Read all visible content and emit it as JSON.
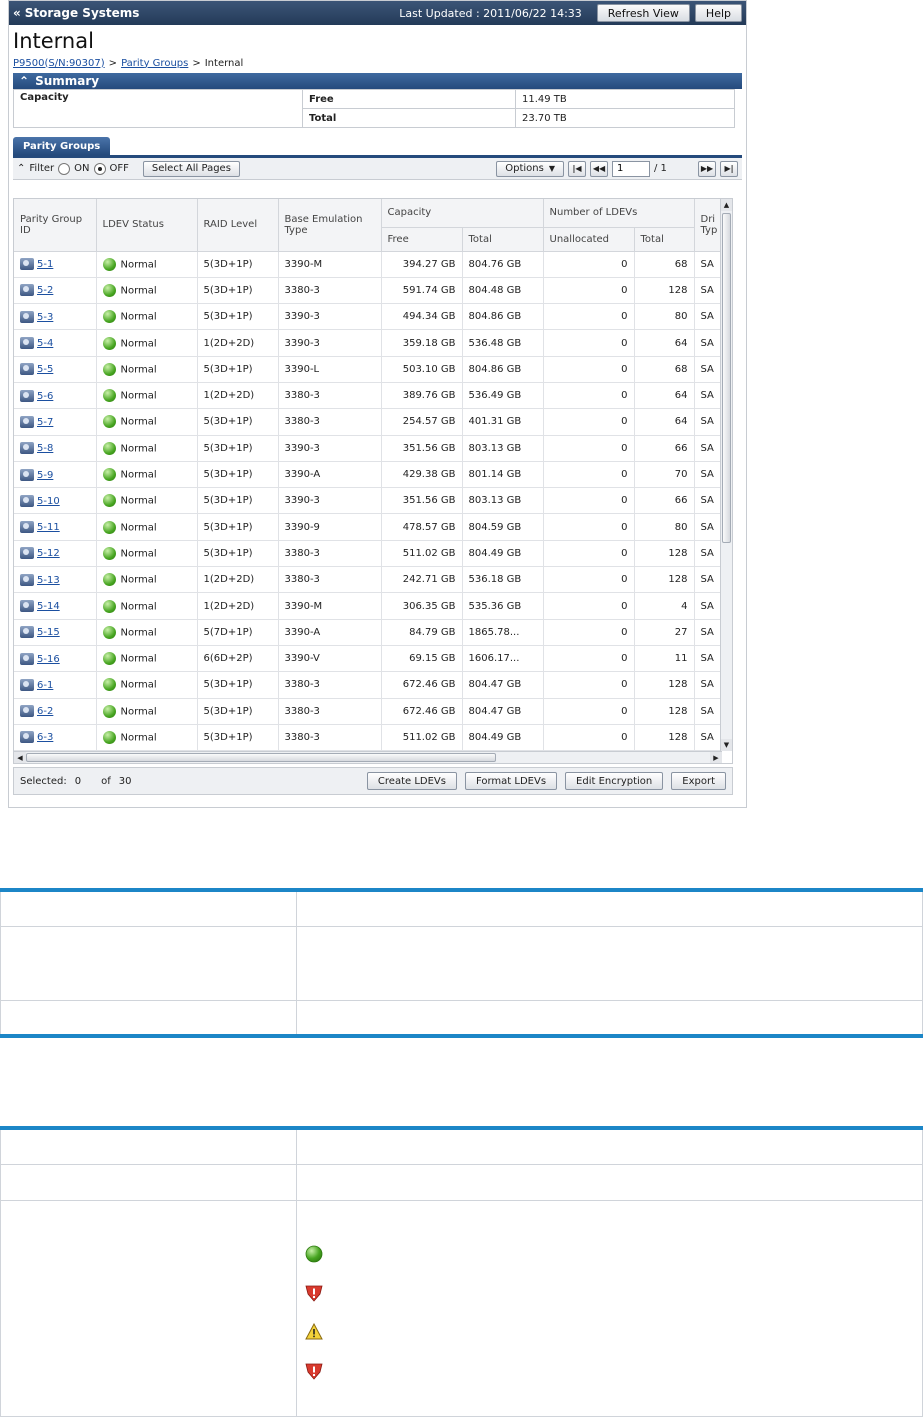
{
  "topbar": {
    "title": "Storage Systems",
    "last_updated": "Last Updated : 2011/06/22 14:33",
    "refresh_label": "Refresh View",
    "help_label": "Help"
  },
  "page": {
    "title": "Internal",
    "breadcrumb": [
      "P9500(S/N:90307)",
      ">",
      "Parity Groups",
      ">",
      "Internal"
    ]
  },
  "summary": {
    "title": "Summary",
    "capacity_label": "Capacity",
    "free_label": "Free",
    "free_value": "11.49 TB",
    "total_label": "Total",
    "total_value": "23.70 TB"
  },
  "parity_groups": {
    "tab_label": "Parity Groups",
    "filter_label": "Filter",
    "on_label": "ON",
    "off_label": "OFF",
    "select_all_label": "Select All Pages",
    "options_label": "Options",
    "page_value": "1",
    "page_total": "/ 1",
    "headers": {
      "pg_id": "Parity Group ID",
      "ldev_status": "LDEV Status",
      "raid_level": "RAID Level",
      "emulation": "Base Emulation Type",
      "capacity": "Capacity",
      "cap_free": "Free",
      "cap_total": "Total",
      "ldevs": "Number of LDEVs",
      "unallocated": "Unallocated",
      "ldev_total": "Total",
      "drive_type": "Dri Typ"
    },
    "rows": [
      {
        "id": "5-1",
        "status": "Normal",
        "raid": "5(3D+1P)",
        "emu": "3390-M",
        "free": "394.27 GB",
        "total": "804.76 GB",
        "unalloc": "0",
        "ldevs": "68",
        "drive": "SA"
      },
      {
        "id": "5-2",
        "status": "Normal",
        "raid": "5(3D+1P)",
        "emu": "3380-3",
        "free": "591.74 GB",
        "total": "804.48 GB",
        "unalloc": "0",
        "ldevs": "128",
        "drive": "SA"
      },
      {
        "id": "5-3",
        "status": "Normal",
        "raid": "5(3D+1P)",
        "emu": "3390-3",
        "free": "494.34 GB",
        "total": "804.86 GB",
        "unalloc": "0",
        "ldevs": "80",
        "drive": "SA"
      },
      {
        "id": "5-4",
        "status": "Normal",
        "raid": "1(2D+2D)",
        "emu": "3390-3",
        "free": "359.18 GB",
        "total": "536.48 GB",
        "unalloc": "0",
        "ldevs": "64",
        "drive": "SA"
      },
      {
        "id": "5-5",
        "status": "Normal",
        "raid": "5(3D+1P)",
        "emu": "3390-L",
        "free": "503.10 GB",
        "total": "804.86 GB",
        "unalloc": "0",
        "ldevs": "68",
        "drive": "SA"
      },
      {
        "id": "5-6",
        "status": "Normal",
        "raid": "1(2D+2D)",
        "emu": "3380-3",
        "free": "389.76 GB",
        "total": "536.49 GB",
        "unalloc": "0",
        "ldevs": "64",
        "drive": "SA"
      },
      {
        "id": "5-7",
        "status": "Normal",
        "raid": "5(3D+1P)",
        "emu": "3380-3",
        "free": "254.57 GB",
        "total": "401.31 GB",
        "unalloc": "0",
        "ldevs": "64",
        "drive": "SA"
      },
      {
        "id": "5-8",
        "status": "Normal",
        "raid": "5(3D+1P)",
        "emu": "3390-3",
        "free": "351.56 GB",
        "total": "803.13 GB",
        "unalloc": "0",
        "ldevs": "66",
        "drive": "SA"
      },
      {
        "id": "5-9",
        "status": "Normal",
        "raid": "5(3D+1P)",
        "emu": "3390-A",
        "free": "429.38 GB",
        "total": "801.14 GB",
        "unalloc": "0",
        "ldevs": "70",
        "drive": "SA"
      },
      {
        "id": "5-10",
        "status": "Normal",
        "raid": "5(3D+1P)",
        "emu": "3390-3",
        "free": "351.56 GB",
        "total": "803.13 GB",
        "unalloc": "0",
        "ldevs": "66",
        "drive": "SA"
      },
      {
        "id": "5-11",
        "status": "Normal",
        "raid": "5(3D+1P)",
        "emu": "3390-9",
        "free": "478.57 GB",
        "total": "804.59 GB",
        "unalloc": "0",
        "ldevs": "80",
        "drive": "SA"
      },
      {
        "id": "5-12",
        "status": "Normal",
        "raid": "5(3D+1P)",
        "emu": "3380-3",
        "free": "511.02 GB",
        "total": "804.49 GB",
        "unalloc": "0",
        "ldevs": "128",
        "drive": "SA"
      },
      {
        "id": "5-13",
        "status": "Normal",
        "raid": "1(2D+2D)",
        "emu": "3380-3",
        "free": "242.71 GB",
        "total": "536.18 GB",
        "unalloc": "0",
        "ldevs": "128",
        "drive": "SA"
      },
      {
        "id": "5-14",
        "status": "Normal",
        "raid": "1(2D+2D)",
        "emu": "3390-M",
        "free": "306.35 GB",
        "total": "535.36 GB",
        "unalloc": "0",
        "ldevs": "4",
        "drive": "SA"
      },
      {
        "id": "5-15",
        "status": "Normal",
        "raid": "5(7D+1P)",
        "emu": "3390-A",
        "free": "84.79 GB",
        "total": "1865.78...",
        "unalloc": "0",
        "ldevs": "27",
        "drive": "SA"
      },
      {
        "id": "5-16",
        "status": "Normal",
        "raid": "6(6D+2P)",
        "emu": "3390-V",
        "free": "69.15 GB",
        "total": "1606.17...",
        "unalloc": "0",
        "ldevs": "11",
        "drive": "SA"
      },
      {
        "id": "6-1",
        "status": "Normal",
        "raid": "5(3D+1P)",
        "emu": "3380-3",
        "free": "672.46 GB",
        "total": "804.47 GB",
        "unalloc": "0",
        "ldevs": "128",
        "drive": "SA"
      },
      {
        "id": "6-2",
        "status": "Normal",
        "raid": "5(3D+1P)",
        "emu": "3380-3",
        "free": "672.46 GB",
        "total": "804.47 GB",
        "unalloc": "0",
        "ldevs": "128",
        "drive": "SA"
      },
      {
        "id": "6-3",
        "status": "Normal",
        "raid": "5(3D+1P)",
        "emu": "3380-3",
        "free": "511.02 GB",
        "total": "804.49 GB",
        "unalloc": "0",
        "ldevs": "128",
        "drive": "SA"
      }
    ]
  },
  "footer": {
    "selected_label": "Selected:",
    "selected_count": "0",
    "of_label": "of",
    "total_count": "30",
    "create_label": "Create LDEVs",
    "format_label": "Format LDEVs",
    "encrypt_label": "Edit Encryption",
    "export_label": "Export"
  },
  "colors": {
    "topbar": "#2d4566",
    "section_bar": "#2e5a8e",
    "doc_rule": "#1c86c7",
    "link": "#1b4fa0",
    "status_normal": "#47a521"
  },
  "doc_icons": [
    "green-circle-icon",
    "red-error-shield-icon",
    "yellow-warning-triangle-icon",
    "red-error-shield-icon"
  ]
}
